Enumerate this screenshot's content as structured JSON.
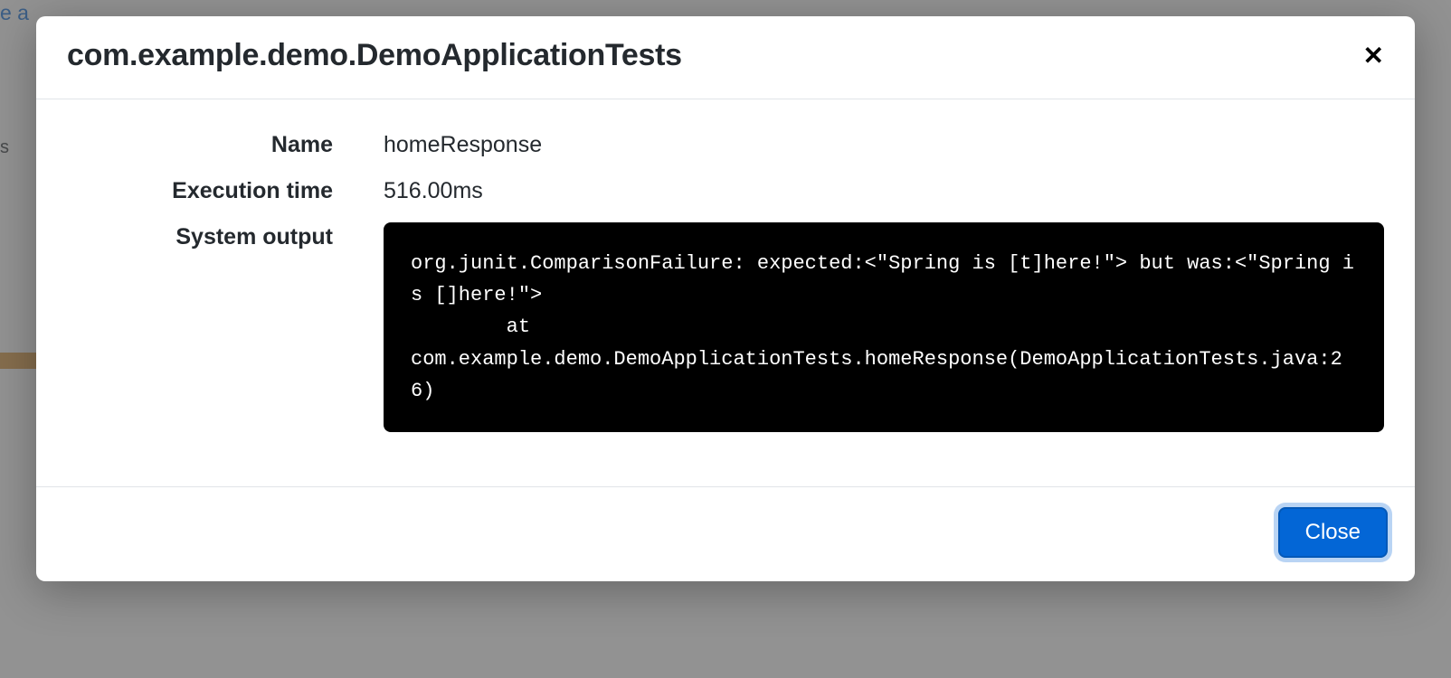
{
  "background": {
    "link_fragment": "e a",
    "text_fragment": "s"
  },
  "modal": {
    "title": "com.example.demo.DemoApplicationTests",
    "fields": {
      "name_label": "Name",
      "name_value": "homeResponse",
      "exec_label": "Execution time",
      "exec_value": "516.00ms",
      "output_label": "System output",
      "output_value": "org.junit.ComparisonFailure: expected:<\"Spring is [t]here!\"> but was:<\"Spring is []here!\">\n        at\ncom.example.demo.DemoApplicationTests.homeResponse(DemoApplicationTests.java:26)"
    },
    "close_icon": "✕",
    "close_button": "Close"
  }
}
